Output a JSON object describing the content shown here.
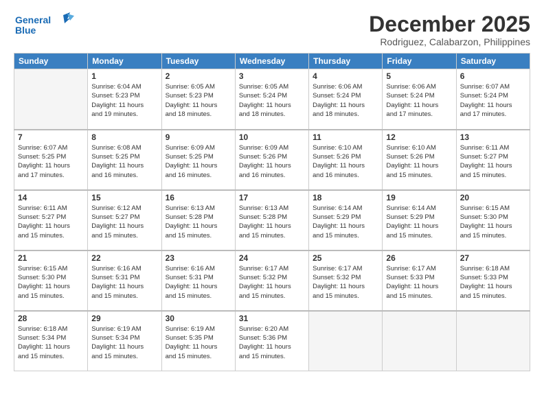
{
  "logo": {
    "line1": "General",
    "line2": "Blue"
  },
  "title": "December 2025",
  "subtitle": "Rodriguez, Calabarzon, Philippines",
  "headers": [
    "Sunday",
    "Monday",
    "Tuesday",
    "Wednesday",
    "Thursday",
    "Friday",
    "Saturday"
  ],
  "weeks": [
    [
      {
        "day": "",
        "info": ""
      },
      {
        "day": "1",
        "info": "Sunrise: 6:04 AM\nSunset: 5:23 PM\nDaylight: 11 hours\nand 19 minutes."
      },
      {
        "day": "2",
        "info": "Sunrise: 6:05 AM\nSunset: 5:23 PM\nDaylight: 11 hours\nand 18 minutes."
      },
      {
        "day": "3",
        "info": "Sunrise: 6:05 AM\nSunset: 5:24 PM\nDaylight: 11 hours\nand 18 minutes."
      },
      {
        "day": "4",
        "info": "Sunrise: 6:06 AM\nSunset: 5:24 PM\nDaylight: 11 hours\nand 18 minutes."
      },
      {
        "day": "5",
        "info": "Sunrise: 6:06 AM\nSunset: 5:24 PM\nDaylight: 11 hours\nand 17 minutes."
      },
      {
        "day": "6",
        "info": "Sunrise: 6:07 AM\nSunset: 5:24 PM\nDaylight: 11 hours\nand 17 minutes."
      }
    ],
    [
      {
        "day": "7",
        "info": "Sunrise: 6:07 AM\nSunset: 5:25 PM\nDaylight: 11 hours\nand 17 minutes."
      },
      {
        "day": "8",
        "info": "Sunrise: 6:08 AM\nSunset: 5:25 PM\nDaylight: 11 hours\nand 16 minutes."
      },
      {
        "day": "9",
        "info": "Sunrise: 6:09 AM\nSunset: 5:25 PM\nDaylight: 11 hours\nand 16 minutes."
      },
      {
        "day": "10",
        "info": "Sunrise: 6:09 AM\nSunset: 5:26 PM\nDaylight: 11 hours\nand 16 minutes."
      },
      {
        "day": "11",
        "info": "Sunrise: 6:10 AM\nSunset: 5:26 PM\nDaylight: 11 hours\nand 16 minutes."
      },
      {
        "day": "12",
        "info": "Sunrise: 6:10 AM\nSunset: 5:26 PM\nDaylight: 11 hours\nand 15 minutes."
      },
      {
        "day": "13",
        "info": "Sunrise: 6:11 AM\nSunset: 5:27 PM\nDaylight: 11 hours\nand 15 minutes."
      }
    ],
    [
      {
        "day": "14",
        "info": "Sunrise: 6:11 AM\nSunset: 5:27 PM\nDaylight: 11 hours\nand 15 minutes."
      },
      {
        "day": "15",
        "info": "Sunrise: 6:12 AM\nSunset: 5:27 PM\nDaylight: 11 hours\nand 15 minutes."
      },
      {
        "day": "16",
        "info": "Sunrise: 6:13 AM\nSunset: 5:28 PM\nDaylight: 11 hours\nand 15 minutes."
      },
      {
        "day": "17",
        "info": "Sunrise: 6:13 AM\nSunset: 5:28 PM\nDaylight: 11 hours\nand 15 minutes."
      },
      {
        "day": "18",
        "info": "Sunrise: 6:14 AM\nSunset: 5:29 PM\nDaylight: 11 hours\nand 15 minutes."
      },
      {
        "day": "19",
        "info": "Sunrise: 6:14 AM\nSunset: 5:29 PM\nDaylight: 11 hours\nand 15 minutes."
      },
      {
        "day": "20",
        "info": "Sunrise: 6:15 AM\nSunset: 5:30 PM\nDaylight: 11 hours\nand 15 minutes."
      }
    ],
    [
      {
        "day": "21",
        "info": "Sunrise: 6:15 AM\nSunset: 5:30 PM\nDaylight: 11 hours\nand 15 minutes."
      },
      {
        "day": "22",
        "info": "Sunrise: 6:16 AM\nSunset: 5:31 PM\nDaylight: 11 hours\nand 15 minutes."
      },
      {
        "day": "23",
        "info": "Sunrise: 6:16 AM\nSunset: 5:31 PM\nDaylight: 11 hours\nand 15 minutes."
      },
      {
        "day": "24",
        "info": "Sunrise: 6:17 AM\nSunset: 5:32 PM\nDaylight: 11 hours\nand 15 minutes."
      },
      {
        "day": "25",
        "info": "Sunrise: 6:17 AM\nSunset: 5:32 PM\nDaylight: 11 hours\nand 15 minutes."
      },
      {
        "day": "26",
        "info": "Sunrise: 6:17 AM\nSunset: 5:33 PM\nDaylight: 11 hours\nand 15 minutes."
      },
      {
        "day": "27",
        "info": "Sunrise: 6:18 AM\nSunset: 5:33 PM\nDaylight: 11 hours\nand 15 minutes."
      }
    ],
    [
      {
        "day": "28",
        "info": "Sunrise: 6:18 AM\nSunset: 5:34 PM\nDaylight: 11 hours\nand 15 minutes."
      },
      {
        "day": "29",
        "info": "Sunrise: 6:19 AM\nSunset: 5:34 PM\nDaylight: 11 hours\nand 15 minutes."
      },
      {
        "day": "30",
        "info": "Sunrise: 6:19 AM\nSunset: 5:35 PM\nDaylight: 11 hours\nand 15 minutes."
      },
      {
        "day": "31",
        "info": "Sunrise: 6:20 AM\nSunset: 5:36 PM\nDaylight: 11 hours\nand 15 minutes."
      },
      {
        "day": "",
        "info": ""
      },
      {
        "day": "",
        "info": ""
      },
      {
        "day": "",
        "info": ""
      }
    ]
  ]
}
